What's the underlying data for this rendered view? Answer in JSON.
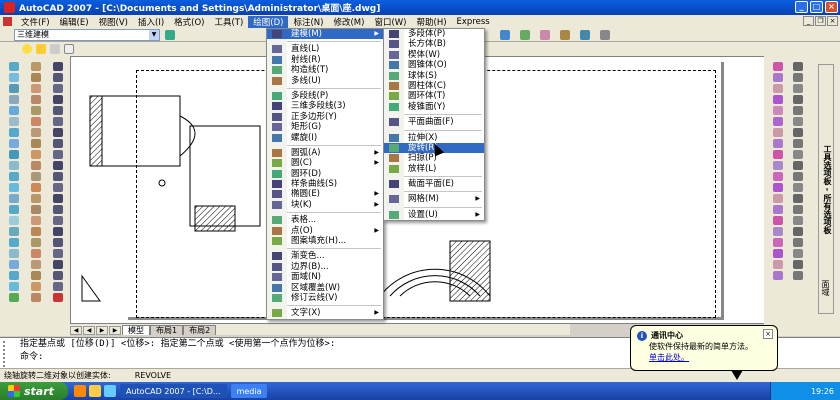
{
  "window": {
    "title": "AutoCAD 2007 - [C:\\Documents and Settings\\Administrator\\桌面\\座.dwg]"
  },
  "menubar": [
    "文件(F)",
    "编辑(E)",
    "视图(V)",
    "插入(I)",
    "格式(O)",
    "工具(T)",
    "绘图(D)",
    "标注(N)",
    "修改(M)",
    "窗口(W)",
    "帮助(H)",
    "Express"
  ],
  "active_menu": "绘图(D)",
  "toolbar": {
    "workspace": "三维建模"
  },
  "draw_menu": {
    "items": [
      {
        "label": "建模(M)",
        "submenu": true,
        "highlight": true
      },
      {
        "sep": true
      },
      {
        "label": "直线(L)"
      },
      {
        "label": "射线(R)"
      },
      {
        "label": "构造线(T)"
      },
      {
        "label": "多线(U)"
      },
      {
        "sep": true
      },
      {
        "label": "多段线(P)"
      },
      {
        "label": "三维多段线(3)"
      },
      {
        "label": "正多边形(Y)"
      },
      {
        "label": "矩形(G)"
      },
      {
        "label": "螺旋(I)"
      },
      {
        "sep": true
      },
      {
        "label": "圆弧(A)",
        "submenu": true
      },
      {
        "label": "圆(C)",
        "submenu": true
      },
      {
        "label": "圆环(D)"
      },
      {
        "label": "样条曲线(S)"
      },
      {
        "label": "椭圆(E)",
        "submenu": true
      },
      {
        "label": "块(K)",
        "submenu": true
      },
      {
        "sep": true
      },
      {
        "label": "表格..."
      },
      {
        "label": "点(O)",
        "submenu": true
      },
      {
        "label": "图案填充(H)..."
      },
      {
        "sep": true
      },
      {
        "label": "渐变色..."
      },
      {
        "label": "边界(B)..."
      },
      {
        "label": "面域(N)"
      },
      {
        "label": "区域覆盖(W)"
      },
      {
        "label": "修订云线(V)"
      },
      {
        "sep": true
      },
      {
        "label": "文字(X)",
        "submenu": true
      }
    ]
  },
  "modeling_submenu": {
    "items": [
      {
        "label": "多段体(P)"
      },
      {
        "label": "长方体(B)"
      },
      {
        "label": "楔体(W)"
      },
      {
        "label": "圆锥体(O)"
      },
      {
        "label": "球体(S)"
      },
      {
        "label": "圆柱体(C)"
      },
      {
        "label": "圆环体(T)"
      },
      {
        "label": "棱锥面(Y)"
      },
      {
        "sep": true
      },
      {
        "label": "平面曲面(F)"
      },
      {
        "sep": true
      },
      {
        "label": "拉伸(X)"
      },
      {
        "label": "旋转(R)",
        "highlight": true
      },
      {
        "label": "扫掠(P)"
      },
      {
        "label": "放样(L)"
      },
      {
        "sep": true
      },
      {
        "label": "截面平面(E)"
      },
      {
        "sep": true
      },
      {
        "label": "网格(M)",
        "submenu": true
      },
      {
        "sep": true
      },
      {
        "label": "设置(U)",
        "submenu": true
      }
    ]
  },
  "layout_tabs": [
    "模型",
    "布局1",
    "布局2"
  ],
  "command_line": [
    "指定基点或 [位移(D)] <位移>:  指定第二个点或 <使用第一个点作为位移>:",
    "命令:"
  ],
  "status": {
    "hint": "绕轴旋转二维对象以创建实体:",
    "command": "REVOLVE"
  },
  "palette_strip": "工具选项板 - 所有选项板",
  "palette_strip_bottom": "面域",
  "balloon": {
    "title": "通讯中心",
    "line1": "使软件保持最新的简单方法。",
    "link": "单击此处。"
  },
  "taskbar": {
    "start": "start",
    "tasks": [
      "AutoCAD 2007 - [C:\\D...",
      "media"
    ],
    "clock": "19:26"
  },
  "colors": {
    "titlebar": "#0a5fe0",
    "menu_highlight": "#316ac5",
    "taskbar": "#1941a5",
    "start": "#2a7d2a"
  }
}
